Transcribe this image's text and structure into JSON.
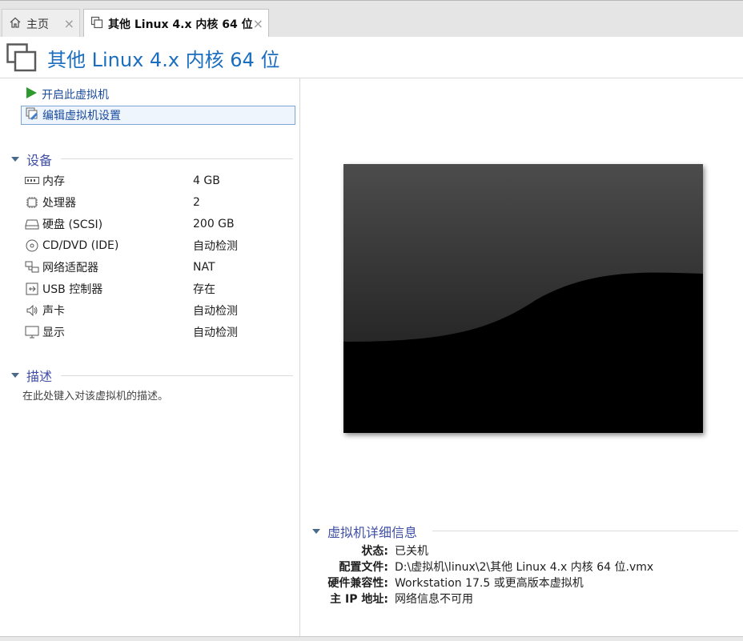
{
  "tabs": [
    {
      "label": "主页",
      "icon": "home-icon",
      "close": "×"
    },
    {
      "label": "其他 Linux 4.x 内核 64 位",
      "icon": "vm-icon",
      "close": "×"
    }
  ],
  "header": {
    "title": "其他 Linux 4.x 内核 64 位",
    "icon": "vm-icon"
  },
  "actions": {
    "start": {
      "label": "开启此虚拟机",
      "icon": "play-icon"
    },
    "edit": {
      "label": "编辑虚拟机设置",
      "icon": "edit-settings-icon"
    }
  },
  "devices": {
    "title": "设备",
    "items": [
      {
        "name": "内存",
        "value": "4 GB",
        "icon": "memory-icon"
      },
      {
        "name": "处理器",
        "value": "2",
        "icon": "cpu-icon"
      },
      {
        "name": "硬盘 (SCSI)",
        "value": "200 GB",
        "icon": "harddisk-icon"
      },
      {
        "name": "CD/DVD (IDE)",
        "value": "自动检测",
        "icon": "cd-icon"
      },
      {
        "name": "网络适配器",
        "value": "NAT",
        "icon": "network-icon"
      },
      {
        "name": "USB 控制器",
        "value": "存在",
        "icon": "usb-icon"
      },
      {
        "name": "声卡",
        "value": "自动检测",
        "icon": "speaker-icon"
      },
      {
        "name": "显示",
        "value": "自动检测",
        "icon": "monitor-icon"
      }
    ]
  },
  "description": {
    "title": "描述",
    "placeholder": "在此处键入对该虚拟机的描述。"
  },
  "details": {
    "title": "虚拟机详细信息",
    "rows": [
      {
        "key": "状态:",
        "value": "已关机"
      },
      {
        "key": "配置文件:",
        "value": "D:\\虚拟机\\linux\\2\\其他 Linux 4.x 内核 64 位.vmx"
      },
      {
        "key": "硬件兼容性:",
        "value": "Workstation 17.5 或更高版本虚拟机"
      },
      {
        "key": "主 IP 地址:",
        "value": "网络信息不可用"
      }
    ]
  },
  "colors": {
    "accent": "#1a6dbf",
    "section": "#3f4fa6",
    "link": "#1a4b9c",
    "play": "#2e9a2e"
  }
}
